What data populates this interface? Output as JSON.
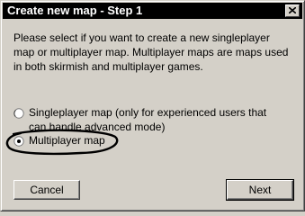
{
  "dialog": {
    "title": "Create new map - Step 1",
    "description": "Please select if you want to create a new singleplayer map or multiplayer map. Multiplayer maps are maps used in both skirmish and multiplayer games.",
    "options": [
      {
        "label": "Singleplayer map (only for experienced users that can handle advanced mode)",
        "selected": false
      },
      {
        "label": "Multiplayer map",
        "selected": true
      }
    ],
    "cancel_label": "Cancel",
    "next_label": "Next"
  },
  "colors": {
    "titlebar": "#000000",
    "background": "#d4d0c8",
    "annotation": "#000000"
  },
  "icons": {
    "close": "close-icon",
    "radio": "radio-icon"
  }
}
